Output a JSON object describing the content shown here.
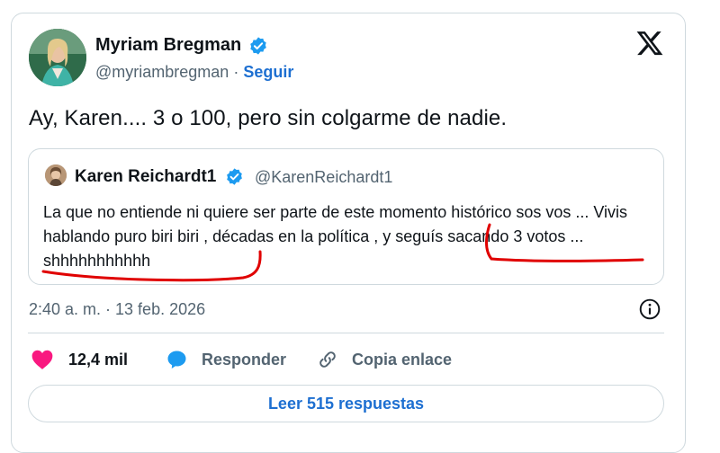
{
  "tweet": {
    "author_name": "Myriam Bregman",
    "author_handle": "@myriambregman",
    "separator": "·",
    "follow_label": "Seguir",
    "text": "Ay, Karen.... 3 o 100, pero sin colgarme de nadie.",
    "timestamp": "2:40 a. m. · 13 feb. 2026"
  },
  "quote": {
    "author_name": "Karen Reichardt1",
    "author_handle": "@KarenReichardt1",
    "text": "La que no entiende ni quiere ser parte de este momento histórico sos vos ... Vivis hablando puro biri biri , décadas en la política , y seguís sacando 3 votos ... shhhhhhhhhhh"
  },
  "actions": {
    "like_count": "12,4 mil",
    "reply_label": "Responder",
    "copy_label": "Copia enlace"
  },
  "read_replies_label": "Leer 515 respuestas",
  "colors": {
    "accent": "#1d6fd1",
    "verified": "#1d9bf0",
    "like": "#f91880",
    "annotation": "#e00000",
    "secondary_text": "#536471"
  },
  "icons": {
    "brand": "x-logo-icon",
    "verified": "verified-badge-icon",
    "like": "heart-icon",
    "reply": "speech-bubble-icon",
    "copy": "link-icon",
    "info": "info-icon"
  }
}
